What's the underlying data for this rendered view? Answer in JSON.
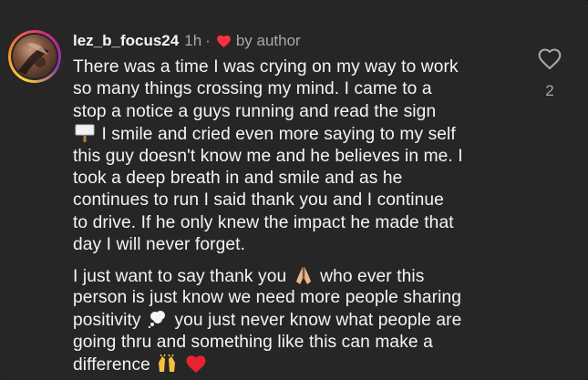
{
  "comment": {
    "username": "lez_b_focus24",
    "time": "1h",
    "separator": "·",
    "author_badge": "by author",
    "like_count": "2",
    "icons": {
      "author_heart": "heart-filled-icon",
      "like": "heart-outline-icon"
    },
    "colors": {
      "background": "#262626",
      "text": "#f5f5f5",
      "muted": "#a8a8a8",
      "heart": "#ff3040"
    },
    "paragraph1": {
      "l1": "There was a time I was crying on my way to work",
      "l2": "so many things crossing my mind. I came to a",
      "l3": "stop a notice a guys running and read the sign",
      "l4_emoji": "signpost-icon",
      "l4": "I smile and cried even more saying to my self",
      "l5": "this guy doesn't know me and he believes in me. I",
      "l6": "took a deep breath in and smile and as he",
      "l7": "continues to run I said thank you and I continue",
      "l8": "to drive. If he only knew the impact he made that",
      "l9": "day I will never forget."
    },
    "paragraph2": {
      "l1a": "I just want to say thank you",
      "l1_emoji": "folded-hands-icon",
      "l1b": "who ever this",
      "l2": "person is just know we need more people sharing",
      "l3a": "positivity",
      "l3_emoji": "thought-balloon-icon",
      "l3b": "you just never know what people are",
      "l4": "going thru and something like this can make a",
      "l5": "difference",
      "l5_emojis": [
        "raising-hands-icon",
        "red-heart-icon"
      ]
    }
  }
}
